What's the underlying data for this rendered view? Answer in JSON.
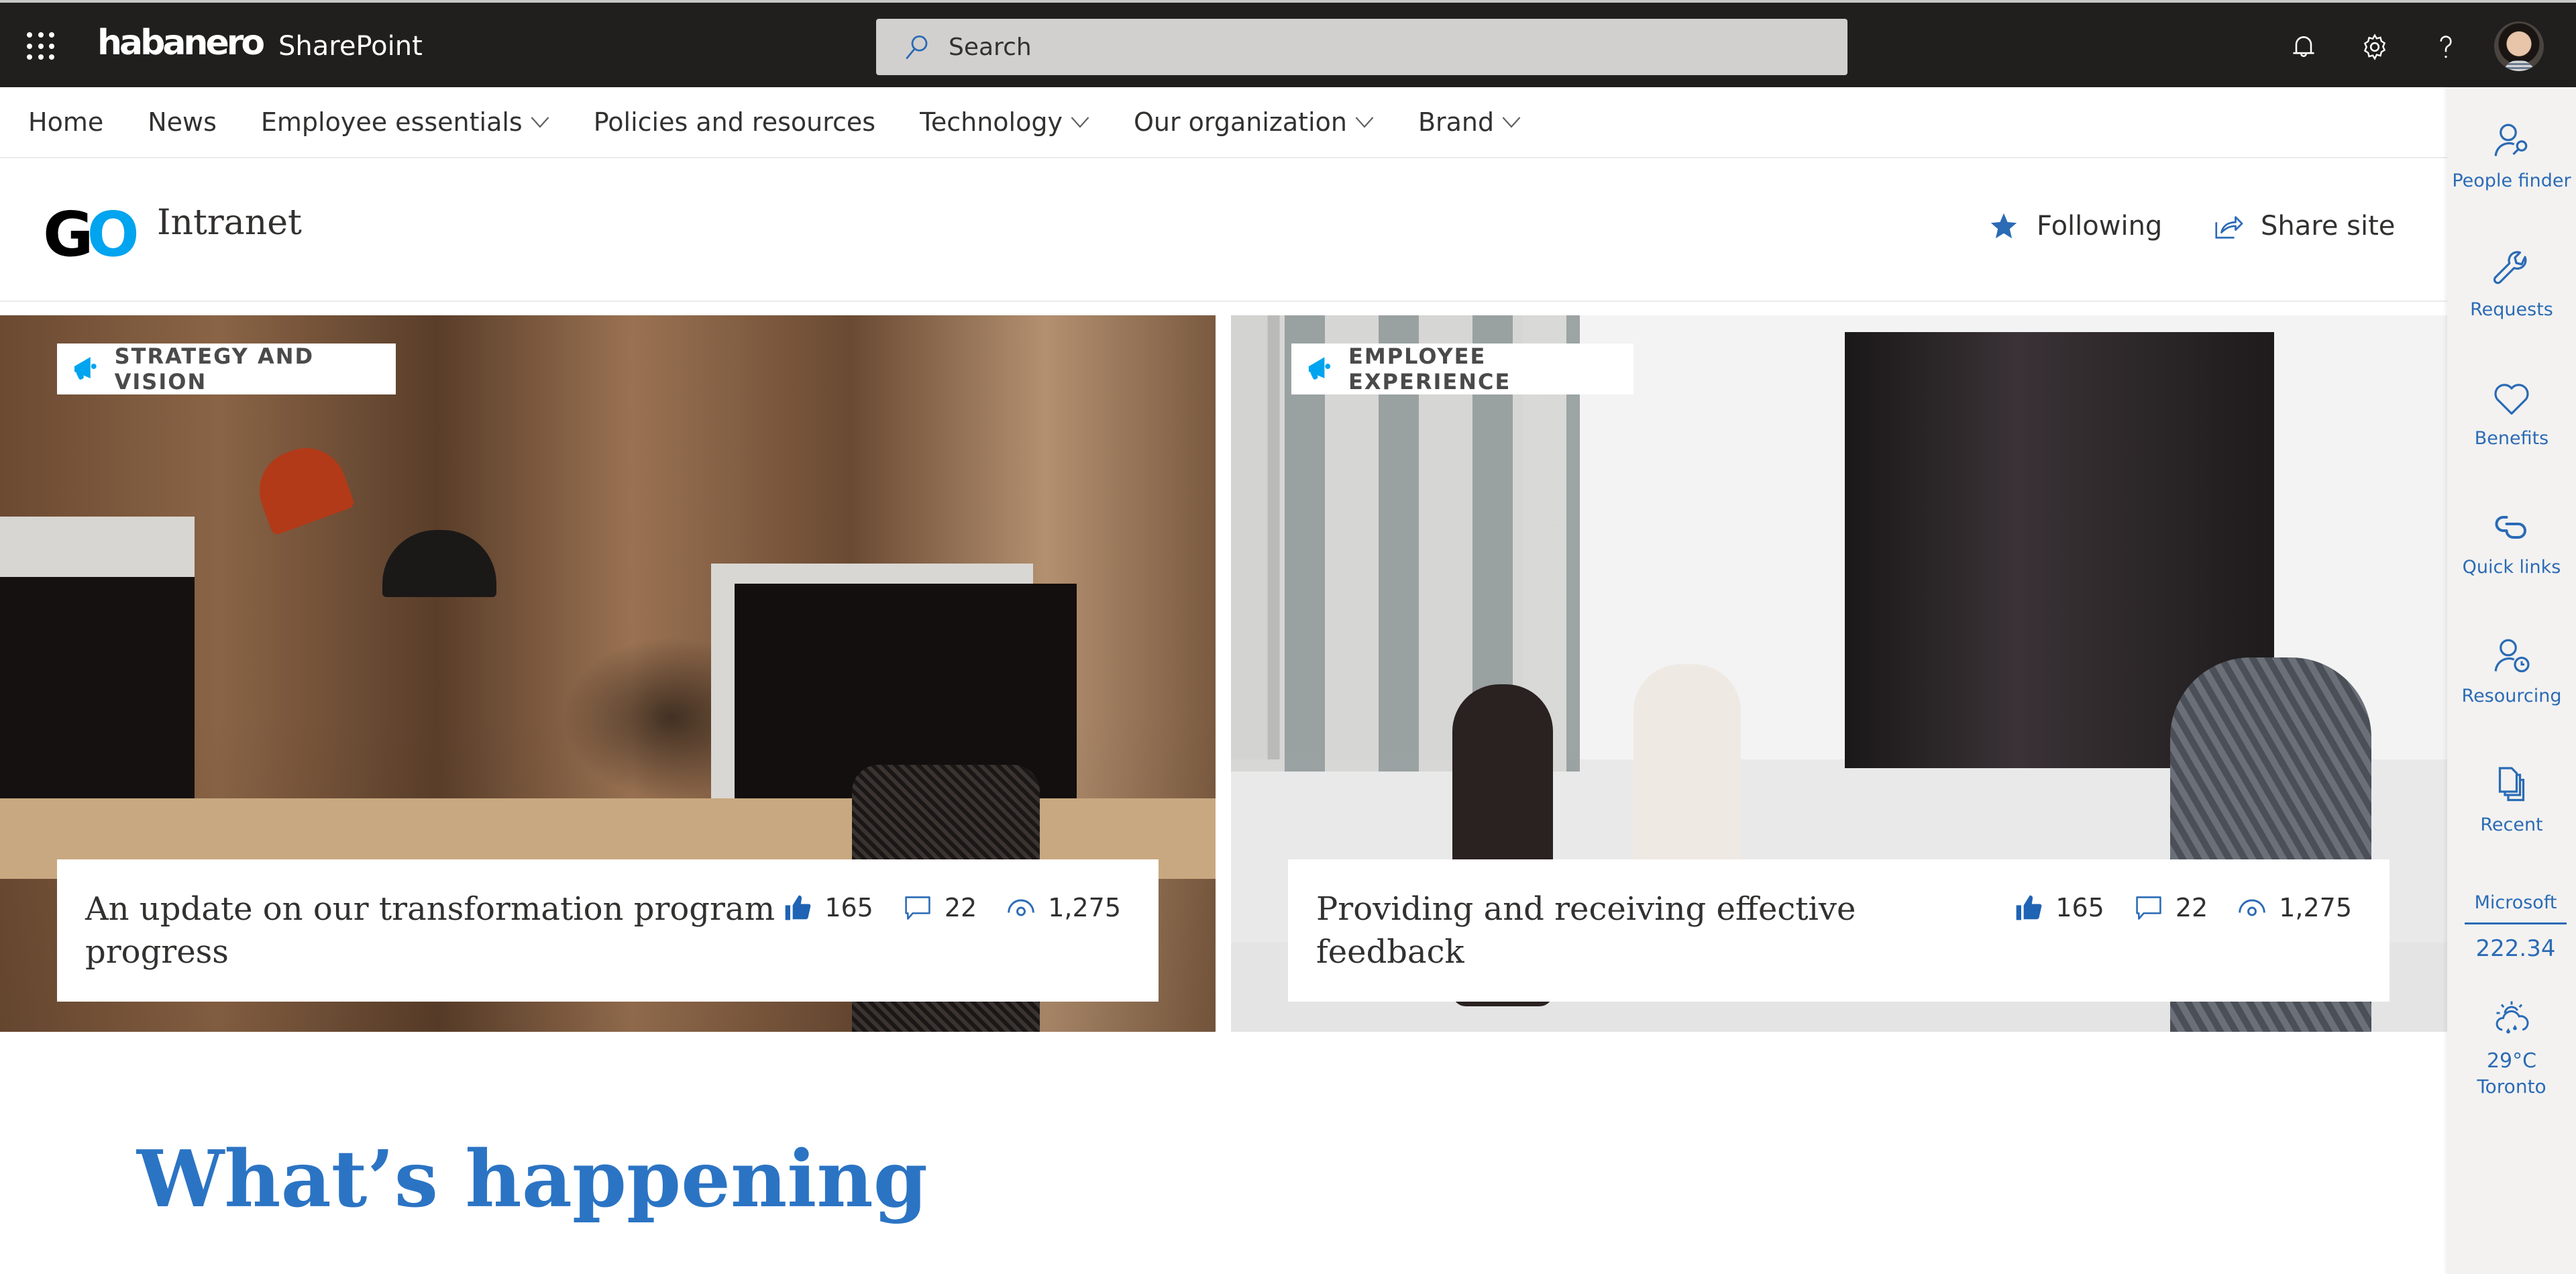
{
  "suite_bar": {
    "brand": "habanero",
    "app_name": "SharePoint",
    "search": {
      "placeholder": "Search",
      "icon": "search-icon"
    },
    "icons": [
      "app-launcher-icon",
      "bell-icon",
      "gear-icon",
      "help-icon"
    ],
    "avatar_alt": "User profile"
  },
  "hub_nav": {
    "items": [
      {
        "label": "Home",
        "has_dropdown": false
      },
      {
        "label": "News",
        "has_dropdown": false
      },
      {
        "label": "Employee essentials",
        "has_dropdown": true
      },
      {
        "label": "Policies and resources",
        "has_dropdown": false
      },
      {
        "label": "Technology",
        "has_dropdown": true
      },
      {
        "label": "Our organization",
        "has_dropdown": true
      },
      {
        "label": "Brand",
        "has_dropdown": true
      }
    ]
  },
  "site_header": {
    "logo": {
      "left": "G",
      "right": "O"
    },
    "title": "Intranet",
    "actions": [
      {
        "label": "Following",
        "icon": "star-icon"
      },
      {
        "label": "Share site",
        "icon": "share-icon"
      }
    ]
  },
  "hero": [
    {
      "category": "STRATEGY AND VISION",
      "category_icon": "megaphone-icon",
      "title": "An update on our transformation program progress",
      "likes": "165",
      "comments": "22",
      "views": "1,275"
    },
    {
      "category": "EMPLOYEE EXPERIENCE",
      "category_icon": "megaphone-icon",
      "title": "Providing and receiving effective feedback",
      "likes": "165",
      "comments": "22",
      "views": "1,275"
    }
  ],
  "rail": {
    "items": [
      {
        "label": "People finder",
        "icon": "people-search-icon"
      },
      {
        "label": "Requests",
        "icon": "wrench-icon"
      },
      {
        "label": "Benefits",
        "icon": "heart-icon"
      },
      {
        "label": "Quick links",
        "icon": "link-icon"
      },
      {
        "label": "Resourcing",
        "icon": "person-clock-icon"
      },
      {
        "label": "Recent",
        "icon": "documents-icon"
      }
    ],
    "stock": {
      "name": "Microsoft",
      "value": "222.34"
    },
    "weather": {
      "icon": "partly-cloudy-rain-icon",
      "temperature": "29°C",
      "city": "Toronto"
    }
  },
  "section": {
    "title": "What’s happening"
  },
  "colors": {
    "suite_bar": "#201f1e",
    "accent_blue": "#2b6bb5",
    "heading_blue": "#2b74c4",
    "logo_cyan": "#00a4ef",
    "rail_bg": "#f3f2f1"
  }
}
